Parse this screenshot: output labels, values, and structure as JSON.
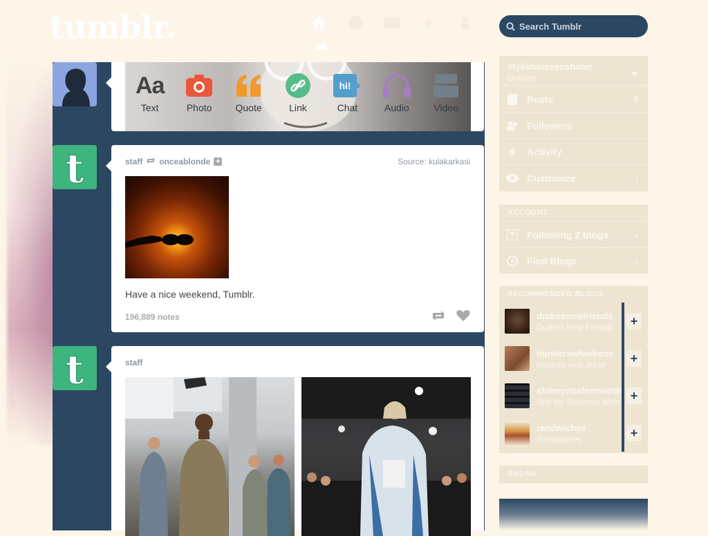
{
  "header": {
    "logo": "tumblr.",
    "nav_icons": [
      "home-icon",
      "compass-icon",
      "envelope-icon",
      "lightning-icon",
      "person-icon"
    ],
    "search_placeholder": "Search Tumblr"
  },
  "composer": {
    "items": [
      {
        "label": "Text",
        "icon": "text-icon",
        "color": "#444444"
      },
      {
        "label": "Photo",
        "icon": "camera-icon",
        "color": "#e8573c"
      },
      {
        "label": "Quote",
        "icon": "quote-icon",
        "color": "#f2992e"
      },
      {
        "label": "Link",
        "icon": "link-icon",
        "color": "#56bc8a"
      },
      {
        "label": "Chat",
        "icon": "chat-icon",
        "color": "#529ecc"
      },
      {
        "label": "Audio",
        "icon": "headphones-icon",
        "color": "#a77dc2"
      },
      {
        "label": "Video",
        "icon": "video-icon",
        "color": "#748089"
      }
    ]
  },
  "posts": [
    {
      "author": "staff",
      "reblogged_from": "onceablonde",
      "source_label": "Source:",
      "source": "kulakarkasi",
      "body": "Have a nice weekend, Tumblr.",
      "notes": "196,889 notes"
    },
    {
      "author": "staff"
    }
  ],
  "sidebar": {
    "blog_name": "stylishscreenshoter",
    "blog_subtitle": "Untitled",
    "blog_items": [
      {
        "label": "Posts",
        "icon": "posts-icon",
        "count": "0"
      },
      {
        "label": "Followers",
        "icon": "followers-icon",
        "count": ""
      },
      {
        "label": "Activity",
        "icon": "activity-icon",
        "count": ""
      },
      {
        "label": "Customize",
        "icon": "eye-icon",
        "count": "›"
      }
    ],
    "account_header": "ACCOUNT",
    "account_items": [
      {
        "label": "Following 2 blogs",
        "icon": "following-icon"
      },
      {
        "label": "Find Blogs",
        "icon": "compass-icon"
      }
    ],
    "recommended_header": "RECOMMENDED BLOGS",
    "recommended": [
      {
        "name": "drakesnewfriends",
        "sub": "Drake's New Friends"
      },
      {
        "name": "hipsterswhodress",
        "sub": "hipsters who dress"
      },
      {
        "name": "shitmystudentswrite",
        "sub": "Shit My Students Write"
      },
      {
        "name": "randwiches",
        "sub": "Randwiches"
      }
    ],
    "radar_header": "RADAR"
  },
  "colors": {
    "background": "#fdf6e8",
    "dashboard_blue": "#2c4762",
    "tumblr_green": "#3eb47f",
    "sidebar_block": "#ede4d2"
  }
}
